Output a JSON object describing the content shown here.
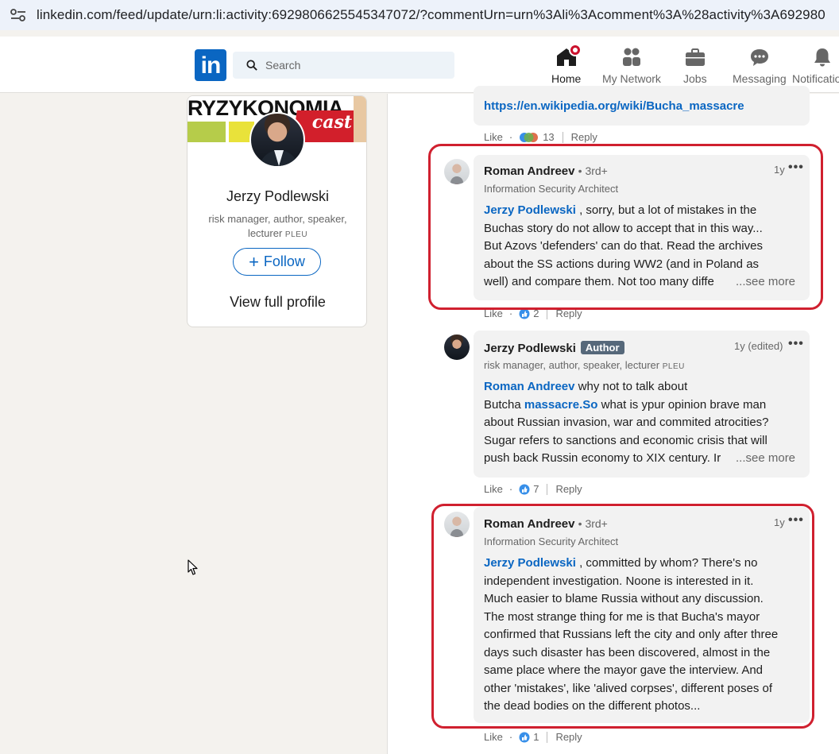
{
  "browser": {
    "url": "linkedin.com/feed/update/urn:li:activity:6929806625545347072/?commentUrn=urn%3Ali%3Acomment%3A%28activity%3A692980"
  },
  "nav": {
    "logo": "in",
    "search_placeholder": "Search",
    "items": [
      {
        "label": "Home",
        "icon": "home-icon",
        "active": true
      },
      {
        "label": "My Network",
        "icon": "network-icon"
      },
      {
        "label": "Jobs",
        "icon": "briefcase-icon"
      },
      {
        "label": "Messaging",
        "icon": "messaging-icon"
      },
      {
        "label": "Notifications",
        "icon": "bell-icon"
      }
    ]
  },
  "profile_card": {
    "banner_text": "RYZYKONOMIA",
    "banner_podcast": "cast",
    "name": "Jerzy Podlewski",
    "headline_part1": "risk manager, author, speaker,",
    "headline_part2": "lecturer",
    "headline_sc": "PLEU",
    "follow_label": "Follow",
    "view_profile_label": "View full profile"
  },
  "prev_comment": {
    "link": "https://en.wikipedia.org/wiki/Bucha_massacre",
    "like": "Like",
    "reaction_count": "13",
    "reply": "Reply"
  },
  "comments": [
    {
      "author": "Roman Andreev",
      "degree": "• 3rd+",
      "headline": "Information Security Architect",
      "time": "1y",
      "mention": "Jerzy Podlewski",
      "lines": [
        " , sorry, but a lot of mistakes in the",
        "Buchas story do not allow to accept that in this way...",
        "But Azovs 'defenders' can do that. Read the archives",
        "about the SS actions during WW2 (and in Poland as",
        "well) and compare them. Not too many diffe"
      ],
      "see_more": "...see more",
      "like": "Like",
      "reaction_count": "2",
      "reply": "Reply"
    },
    {
      "author": "Jerzy Podlewski",
      "author_badge": "Author",
      "headline_part": "risk manager, author, speaker, lecturer",
      "headline_sc": "PLEU",
      "time": "1y (edited)",
      "mention": "Roman Andreev",
      "line1_rest": " why not to talk about",
      "line2_pre": "Butcha ",
      "line2_link": "massacre.So",
      "line2_rest": " what is ypur opinion brave man",
      "lines": [
        "about Russian invasion, war and commited atrocities?",
        "Sugar refers to sanctions and economic crisis that will",
        "push back Russin economy to XIX century. Ir"
      ],
      "see_more": "...see more",
      "like": "Like",
      "reaction_count": "7",
      "reply": "Reply"
    },
    {
      "author": "Roman Andreev",
      "degree": "• 3rd+",
      "headline": "Information Security Architect",
      "time": "1y",
      "mention": "Jerzy Podlewski",
      "lines": [
        " , committed by whom? There's no",
        "independent investigation. Noone is interested in it.",
        "Much easier to blame Russia without any discussion.",
        "The most strange thing for me is that Bucha's mayor",
        "confirmed that Russians left the city and only after three",
        "days such disaster has been discovered, almost in the",
        "same place where the mayor gave the interview. And",
        "other 'mistakes', like 'alived corpses', different poses of",
        "the dead bodies on the different photos..."
      ],
      "like": "Like",
      "reaction_count": "1",
      "reply": "Reply"
    }
  ],
  "colors": {
    "linkedin_blue": "#0a66c2",
    "highlight_red": "#d0202f",
    "notification_red": "#cb112d"
  }
}
